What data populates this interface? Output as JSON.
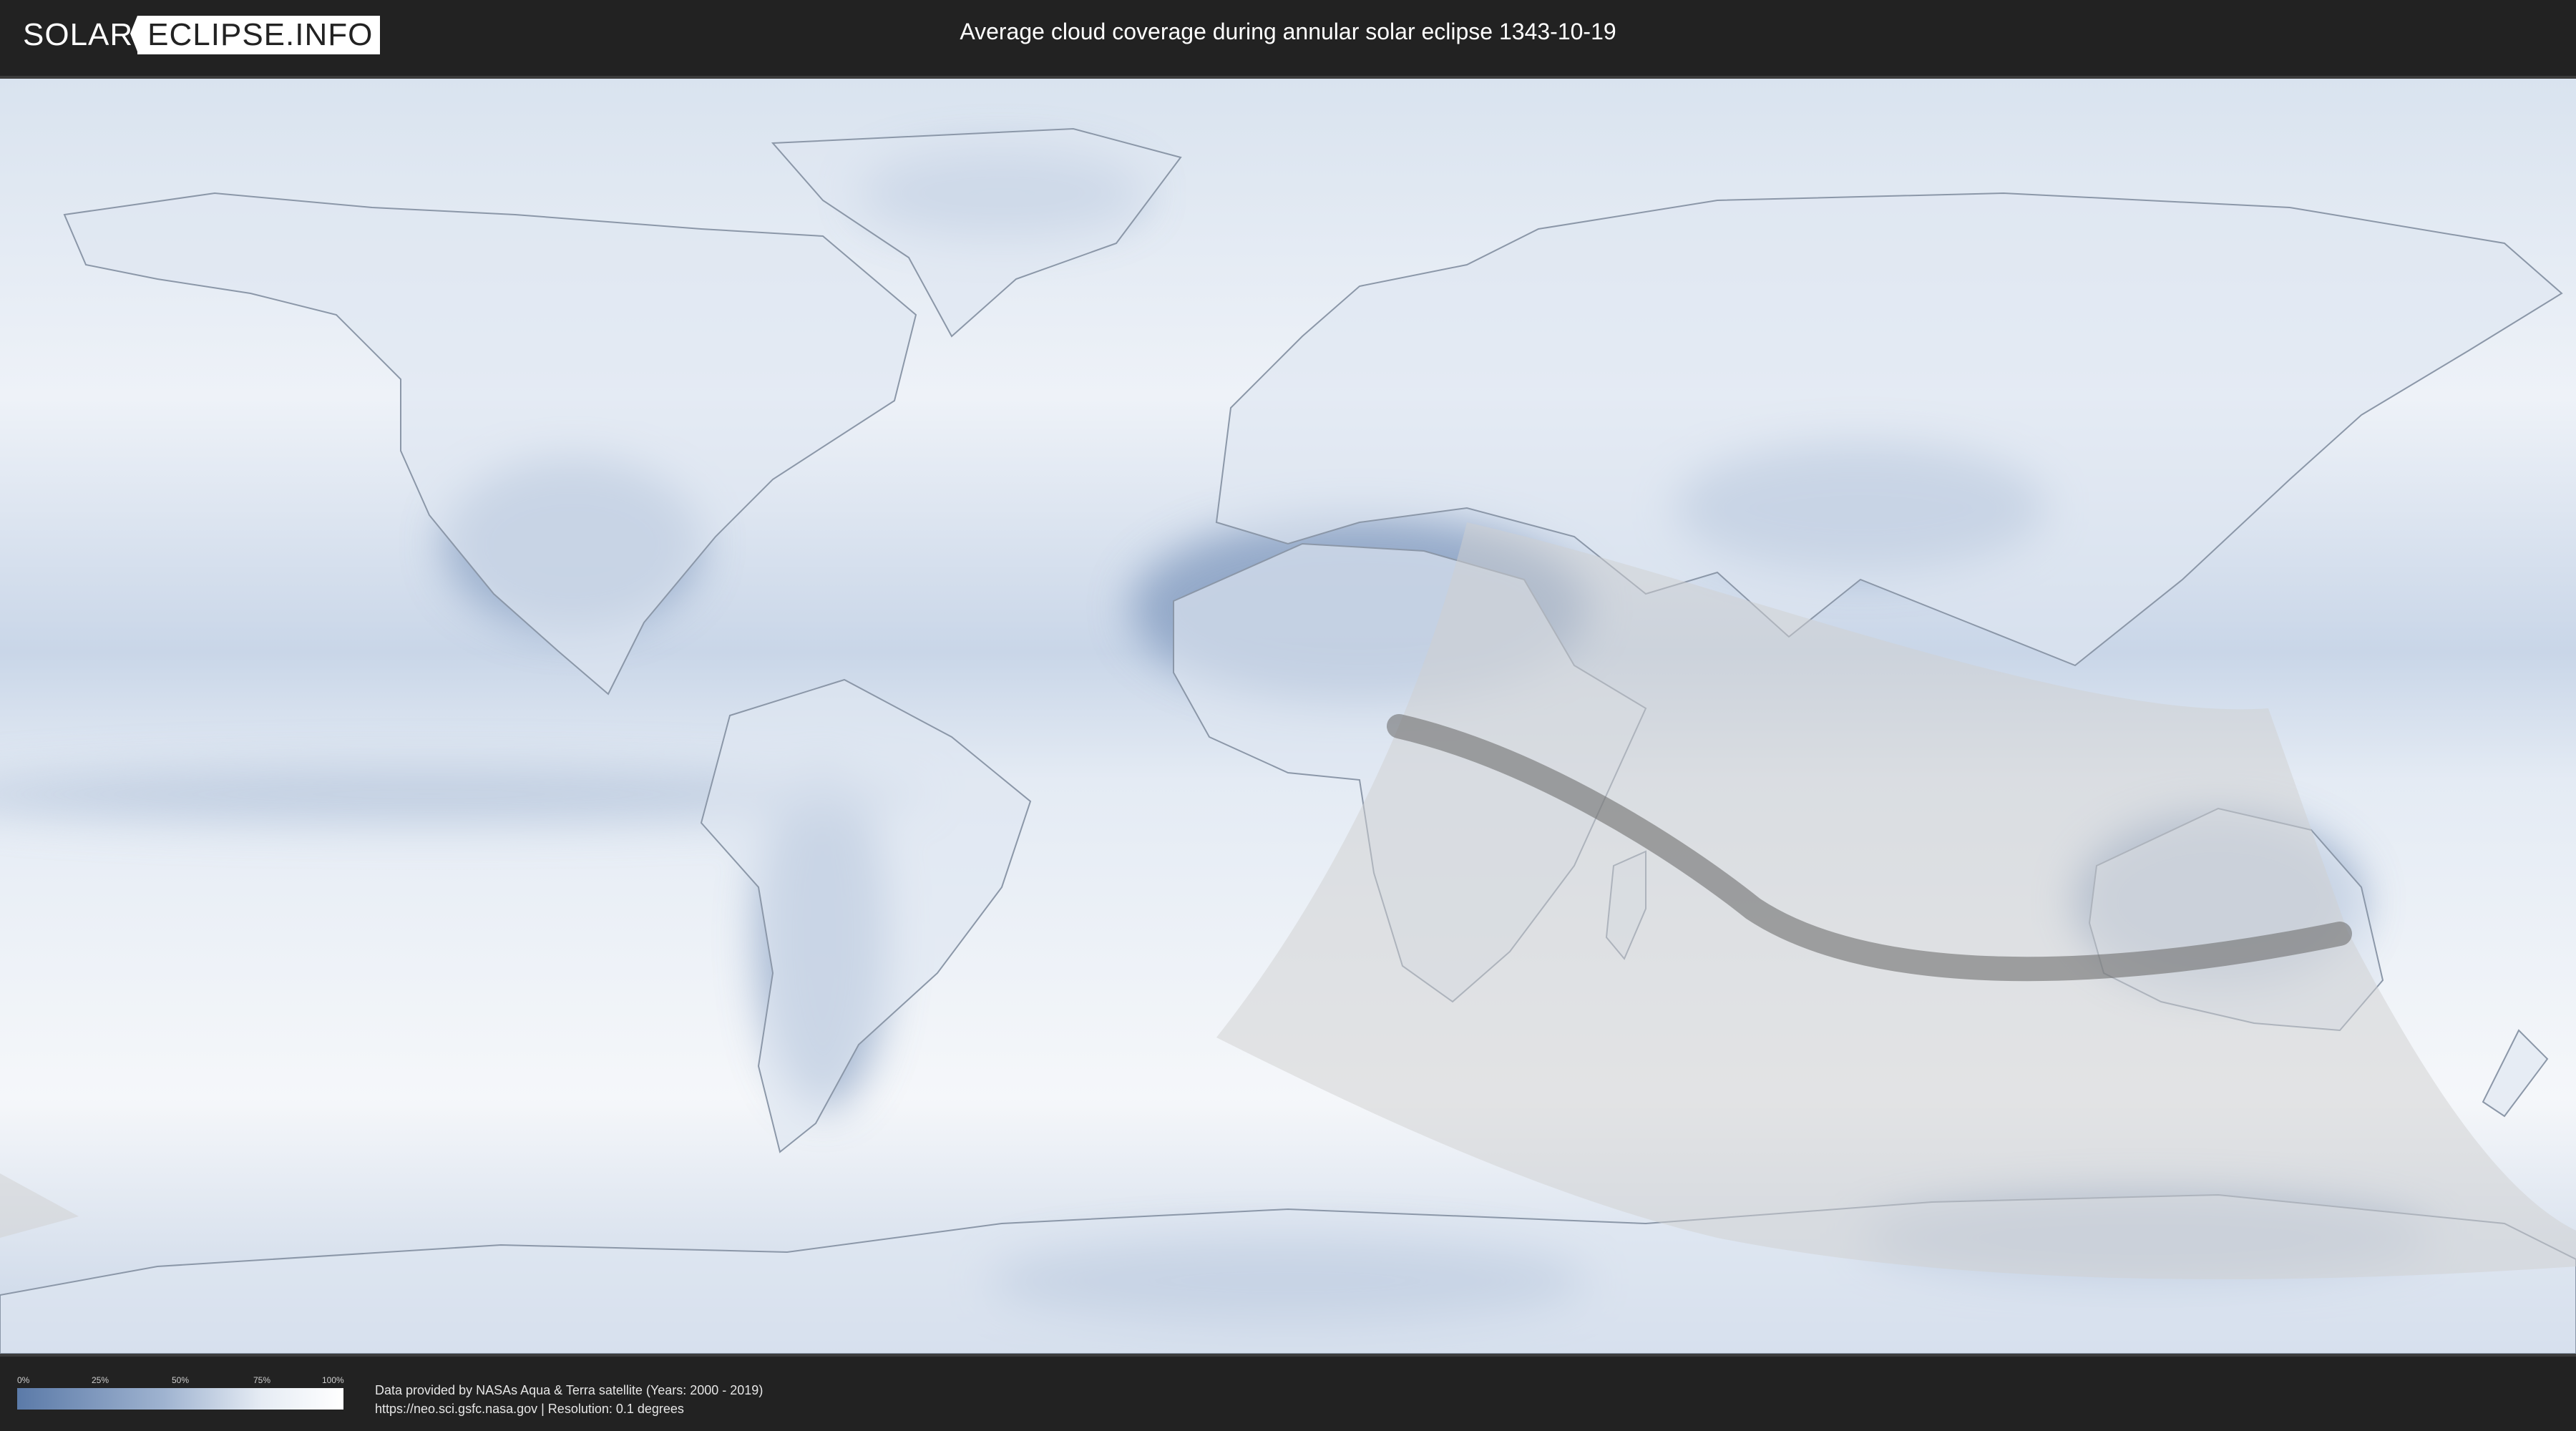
{
  "header": {
    "logo_left": "SOLAR",
    "logo_right": "ECLIPSE.INFO",
    "title": "Average cloud coverage during annular solar eclipse 1343-10-19"
  },
  "legend": {
    "ticks": [
      "0%",
      "25%",
      "50%",
      "75%",
      "100%"
    ],
    "colors": [
      "#5b7aa8",
      "#9fb3d0",
      "#e6ecf4",
      "#ffffff"
    ]
  },
  "footer": {
    "credit_line_1": "Data provided by NASAs Aqua & Terra satellite (Years: 2000 - 2019)",
    "credit_line_2": "https://neo.sci.gsfc.nasa.gov | Resolution: 0.1 degrees"
  },
  "map": {
    "ocean_color": "#eef2f8",
    "cloud_dark_color": "#6a88b4",
    "penumbra_color": "#cfcfcf",
    "path_color": "#707070"
  }
}
